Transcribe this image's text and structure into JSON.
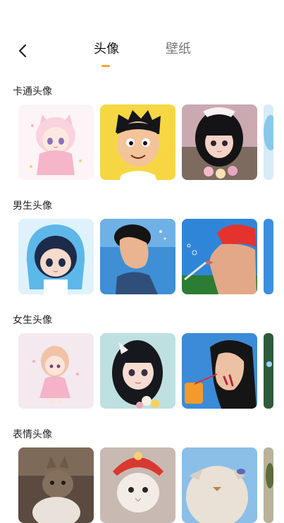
{
  "header": {
    "back_icon": "chevron-left-icon",
    "tabs": [
      {
        "label": "头像",
        "active": true
      },
      {
        "label": "壁纸",
        "active": false
      }
    ],
    "accent_color": "#f3a53a"
  },
  "sections": [
    {
      "title": "卡通头像",
      "tiles": [
        "anime-pink-girl",
        "cartoon-boy",
        "anime-girl-bow"
      ]
    },
    {
      "title": "男生头像",
      "tiles": [
        "chibi-boy-hoodie",
        "boy-sky-portrait",
        "boy-red-hair"
      ]
    },
    {
      "title": "女生头像",
      "tiles": [
        "chibi-girl-pink",
        "anime-girl-flowers",
        "girl-drink"
      ]
    },
    {
      "title": "表情头像",
      "tiles": [
        "cat-meme",
        "cat-headdress",
        "fluffy-chicken"
      ]
    }
  ]
}
